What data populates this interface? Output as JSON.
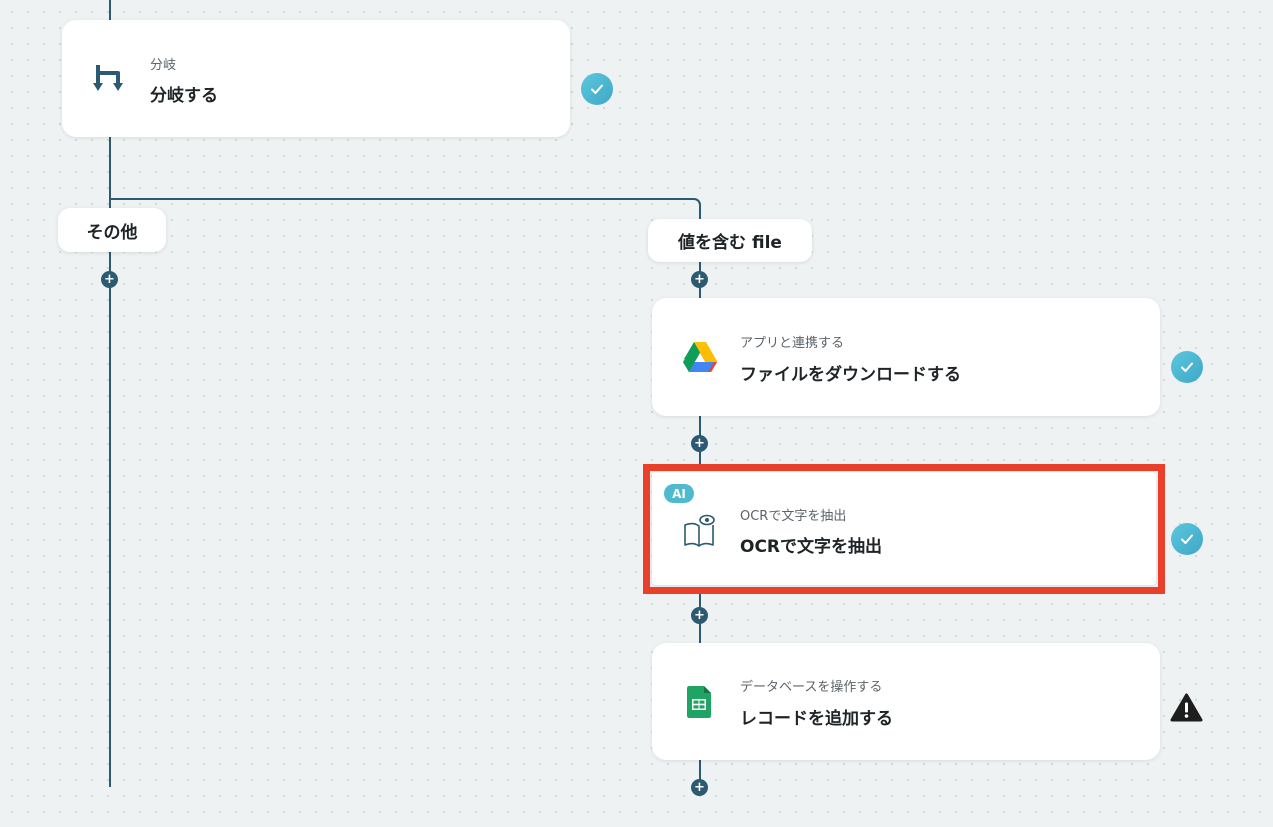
{
  "branch_step": {
    "subtitle": "分岐",
    "title": "分岐する"
  },
  "branches": {
    "left_label": "その他",
    "right_label": "値を含む file"
  },
  "steps": [
    {
      "subtitle": "アプリと連携する",
      "title": "ファイルをダウンロードする",
      "icon": "google-drive-icon",
      "status": "complete"
    },
    {
      "subtitle": "OCRで文字を抽出",
      "title": "OCRで文字を抽出",
      "icon": "ocr-book-eye-icon",
      "badge": "AI",
      "status": "complete",
      "highlighted": true
    },
    {
      "subtitle": "データベースを操作する",
      "title": "レコードを追加する",
      "icon": "google-sheets-icon",
      "status": "warning"
    }
  ],
  "colors": {
    "connector": "#2b5a72",
    "check": "#4fb9cf",
    "highlight": "#e8402a",
    "warning": "#1e1e1e"
  }
}
